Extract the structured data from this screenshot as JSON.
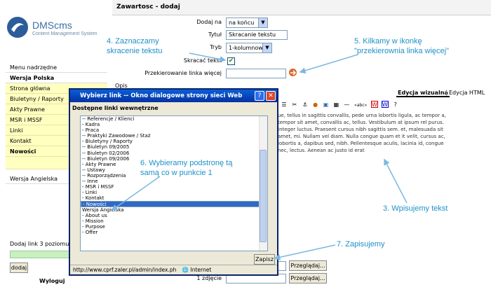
{
  "app": {
    "logo_text": "DMScms",
    "logo_sub": "Content Management System"
  },
  "sidebar": {
    "menu_parent": "Menu nadrzędne",
    "version_pl": "Wersja Polska",
    "items": [
      "Strona główna",
      "Biuletyny / Raporty",
      "Akty Prawne",
      "MSR i MSSF",
      "Linki",
      "Kontakt",
      "Nowości"
    ],
    "version_en": "Wersja Angielska",
    "add_level_label": "Dodaj link 3 poziomu",
    "add_button": "dodaj",
    "logout": "Wyloguj"
  },
  "main": {
    "section_title": "Zawartosc - dodaj",
    "fields": {
      "add_on_label": "Dodaj na",
      "add_on_value": "na końcu",
      "title_label": "Tytuł",
      "title_value": "Skracanie tekstu",
      "mode_label": "Tryb",
      "mode_value": "1-kolumnowy",
      "shorten_label": "Skracać tekst",
      "redirect_label": "Przekierowanie linka więcej",
      "desc_label": "Opis"
    },
    "editor_tabs": [
      "Edycja wizualna",
      "Edycja HTML"
    ],
    "editor_text": "ue, tellus in sagittis convallis, pede urna lobortis ligula, ac tempor a, tempor sit amet, convallis ac, tellus. Vestibulum at ipsum rel purus. Integer luctus. Praesent cursus nibh sagittis sem. et, malesuada sit amet, mi. Nullam vel diam. Nulla congue quam et it velit, cursus ac, lobortis a, dapibus sed, nibh. Pellentesque aculis, lacinia id, congue nec, lectus. Aenean ac justo id erat",
    "browse_button": "Przeglądaj...",
    "photo_label": "1 zdjęcie"
  },
  "dialog": {
    "title": "Wybierz link -- Okno dialogowe strony sieci Web",
    "subtitle": "Dostępne linki wewnętrzne",
    "list": [
      "-- Referencje / Klienci",
      "- Kadra",
      "- Praca",
      "-- Praktyki Zawodowe / Staż",
      "- Biuletyny / Raporty",
      "-- Biuletyn 09/2005",
      "-- Biuletyn 02/2006",
      "-- Biuletyn 09/2006",
      "- Akty Prawne",
      "-- Ustawy",
      "-- Rozporządzenia",
      "-- Inne",
      "- MSR i MSSF",
      "- Linki",
      "- Kontakt",
      "- Nowości",
      "Wersja Angielska",
      "- About us",
      "- Mission",
      "- Purpose",
      "- Offer"
    ],
    "selected_index": 15,
    "submit": "Zapisz",
    "status_url": "http://www.cprf.zaler.pl/admin/index.ph",
    "status_zone": "Internet"
  },
  "annotations": {
    "a4": "4. Zaznaczamy",
    "a4b": "skracenie tekstu",
    "a5": "5. Kilkamy w ikonkę",
    "a5b": "\"przekierownia linka więcej\"",
    "a6": "6. Wybieramy podstronę tą",
    "a6b": "samą co w punkcie 1",
    "a3": "3. Wpisujemy tekst",
    "a7": "7. Zapisujemy"
  },
  "colors": {
    "accent": "#1e90c8",
    "title_bar": "#0a5fd8",
    "selection": "#316ac5",
    "sidebar_yellow": "#ffffc0"
  }
}
